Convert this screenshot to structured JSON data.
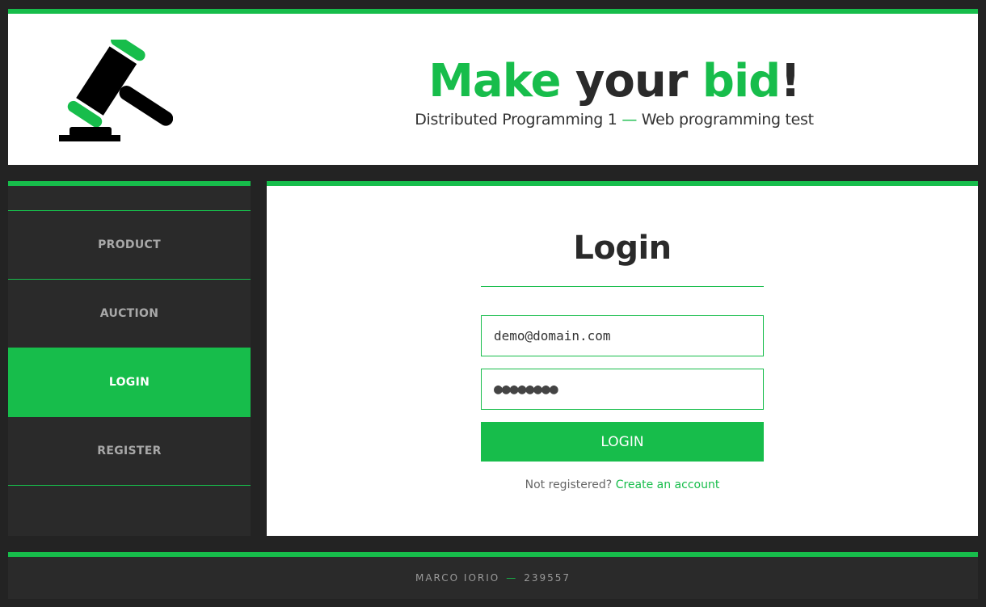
{
  "header": {
    "title_part1": "Make",
    "title_part2": " your ",
    "title_part3": "bid",
    "title_part4": "!",
    "subtitle_left": "Distributed Programming 1",
    "subtitle_sep": " — ",
    "subtitle_right": "Web programming test"
  },
  "sidebar": {
    "items": [
      {
        "label": "PRODUCT"
      },
      {
        "label": "AUCTION"
      },
      {
        "label": "LOGIN"
      },
      {
        "label": "REGISTER"
      }
    ]
  },
  "login": {
    "title": "Login",
    "email_value": "demo@domain.com",
    "password_mask": "●●●●●●●●",
    "button_label": "LOGIN",
    "register_prompt": "Not registered? ",
    "register_link": "Create an account"
  },
  "footer": {
    "author": "MARCO IORIO",
    "sep": "—",
    "id": "239557"
  },
  "icons": {
    "logo": "gavel-icon"
  },
  "colors": {
    "accent": "#17bd4b",
    "background": "#232323",
    "panel_dark": "#2a2a2a"
  }
}
